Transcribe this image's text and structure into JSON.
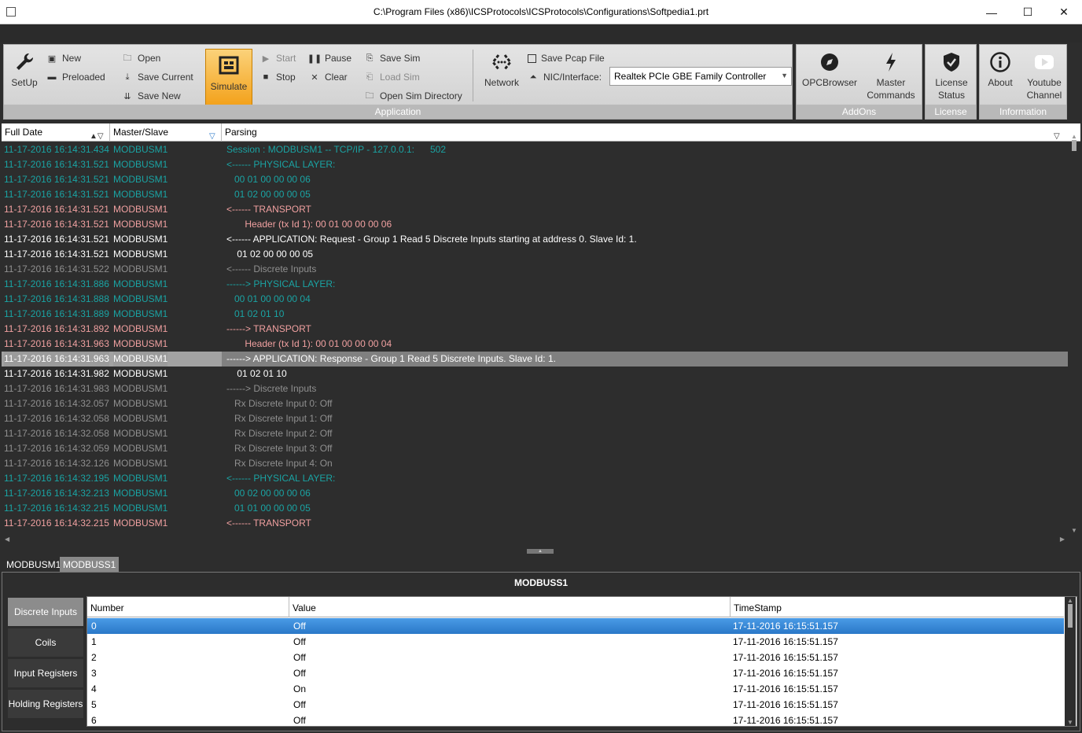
{
  "window": {
    "title": "C:\\Program Files (x86)\\ICSProtocols\\ICSProtocols\\Configurations\\Softpedia1.prt",
    "minimize": "—",
    "maximize": "☐",
    "close": "✕"
  },
  "ribbon": {
    "application": {
      "title": "Application",
      "setup": "SetUp",
      "new": "New",
      "preloaded": "Preloaded",
      "open": "Open",
      "save_current": "Save Current",
      "save_new": "Save New",
      "simulate": "Simulate",
      "start": "Start",
      "stop": "Stop",
      "pause": "Pause",
      "clear": "Clear",
      "save_sim": "Save Sim",
      "load_sim": "Load Sim",
      "open_sim_dir": "Open Sim Directory",
      "network": "Network",
      "save_pcap": "Save Pcap File",
      "nic_label": "NIC/Interface:",
      "nic_value": "Realtek PCIe GBE Family Controller"
    },
    "addons": {
      "title": "AddOns",
      "opcbrowser": "OPCBrowser",
      "master_commands_1": "Master",
      "master_commands_2": "Commands"
    },
    "license": {
      "title": "License",
      "license_status_1": "License",
      "license_status_2": "Status"
    },
    "information": {
      "title": "Information",
      "about": "About",
      "youtube_1": "Youtube",
      "youtube_2": "Channel"
    }
  },
  "log": {
    "columns": [
      "Full Date",
      "Master/Slave",
      "Parsing"
    ],
    "rows": [
      {
        "date": "11-17-2016 16:14:31.434",
        "ms": "MODBUSM1",
        "parsing": "Session : MODBUSM1 -- TCP/IP - 127.0.0.1:      502",
        "style": "teal"
      },
      {
        "date": "11-17-2016 16:14:31.521",
        "ms": "MODBUSM1",
        "parsing": "<------ PHYSICAL LAYER:",
        "style": "teal"
      },
      {
        "date": "11-17-2016 16:14:31.521",
        "ms": "MODBUSM1",
        "parsing": "   00 01 00 00 00 06",
        "style": "teal"
      },
      {
        "date": "11-17-2016 16:14:31.521",
        "ms": "MODBUSM1",
        "parsing": "   01 02 00 00 00 05",
        "style": "teal"
      },
      {
        "date": "11-17-2016 16:14:31.521",
        "ms": "MODBUSM1",
        "parsing": "<------ TRANSPORT",
        "style": "red"
      },
      {
        "date": "11-17-2016 16:14:31.521",
        "ms": "MODBUSM1",
        "parsing": "       Header (tx Id 1): 00 01 00 00 00 06",
        "style": "red"
      },
      {
        "date": "11-17-2016 16:14:31.521",
        "ms": "MODBUSM1",
        "parsing": "<------ APPLICATION: Request - Group 1 Read 5 Discrete Inputs starting at address 0. Slave Id: 1.",
        "style": "white"
      },
      {
        "date": "11-17-2016 16:14:31.521",
        "ms": "MODBUSM1",
        "parsing": "    01 02 00 00 00 05",
        "style": "white"
      },
      {
        "date": "11-17-2016 16:14:31.522",
        "ms": "MODBUSM1",
        "parsing": "<------ Discrete Inputs",
        "style": "gray"
      },
      {
        "date": "11-17-2016 16:14:31.886",
        "ms": "MODBUSM1",
        "parsing": "------> PHYSICAL LAYER:",
        "style": "teal"
      },
      {
        "date": "11-17-2016 16:14:31.888",
        "ms": "MODBUSM1",
        "parsing": "   00 01 00 00 00 04",
        "style": "teal"
      },
      {
        "date": "11-17-2016 16:14:31.889",
        "ms": "MODBUSM1",
        "parsing": "   01 02 01 10",
        "style": "teal"
      },
      {
        "date": "11-17-2016 16:14:31.892",
        "ms": "MODBUSM1",
        "parsing": "------> TRANSPORT",
        "style": "red"
      },
      {
        "date": "11-17-2016 16:14:31.963",
        "ms": "MODBUSM1",
        "parsing": "       Header (tx Id 1): 00 01 00 00 00 04",
        "style": "red"
      },
      {
        "date": "11-17-2016 16:14:31.963",
        "ms": "MODBUSM1",
        "parsing": "------> APPLICATION: Response - Group 1 Read 5 Discrete Inputs. Slave Id: 1.",
        "style": "sel"
      },
      {
        "date": "11-17-2016 16:14:31.982",
        "ms": "MODBUSM1",
        "parsing": "    01 02 01 10",
        "style": "white"
      },
      {
        "date": "11-17-2016 16:14:31.983",
        "ms": "MODBUSM1",
        "parsing": "------> Discrete Inputs",
        "style": "gray"
      },
      {
        "date": "11-17-2016 16:14:32.057",
        "ms": "MODBUSM1",
        "parsing": "   Rx Discrete Input 0: Off",
        "style": "gray"
      },
      {
        "date": "11-17-2016 16:14:32.058",
        "ms": "MODBUSM1",
        "parsing": "   Rx Discrete Input 1: Off",
        "style": "gray"
      },
      {
        "date": "11-17-2016 16:14:32.058",
        "ms": "MODBUSM1",
        "parsing": "   Rx Discrete Input 2: Off",
        "style": "gray"
      },
      {
        "date": "11-17-2016 16:14:32.059",
        "ms": "MODBUSM1",
        "parsing": "   Rx Discrete Input 3: Off",
        "style": "gray"
      },
      {
        "date": "11-17-2016 16:14:32.126",
        "ms": "MODBUSM1",
        "parsing": "   Rx Discrete Input 4: On",
        "style": "gray"
      },
      {
        "date": "11-17-2016 16:14:32.195",
        "ms": "MODBUSM1",
        "parsing": "<------ PHYSICAL LAYER:",
        "style": "teal"
      },
      {
        "date": "11-17-2016 16:14:32.213",
        "ms": "MODBUSM1",
        "parsing": "   00 02 00 00 00 06",
        "style": "teal"
      },
      {
        "date": "11-17-2016 16:14:32.215",
        "ms": "MODBUSM1",
        "parsing": "   01 01 00 00 00 05",
        "style": "teal"
      },
      {
        "date": "11-17-2016 16:14:32.215",
        "ms": "MODBUSM1",
        "parsing": "<------ TRANSPORT",
        "style": "red"
      }
    ]
  },
  "bottom": {
    "tabs": [
      "MODBUSM1",
      "MODBUSS1"
    ],
    "active_tab": 1,
    "panel_title": "MODBUSS1",
    "side_tabs": [
      "Discrete Inputs",
      "Coils",
      "Input Registers",
      "Holding Registers"
    ],
    "table": {
      "columns": [
        "Number",
        "Value",
        "TimeStamp"
      ],
      "rows": [
        {
          "number": "0",
          "value": "Off",
          "timestamp": "17-11-2016 16:15:51.157"
        },
        {
          "number": "1",
          "value": "Off",
          "timestamp": "17-11-2016 16:15:51.157"
        },
        {
          "number": "2",
          "value": "Off",
          "timestamp": "17-11-2016 16:15:51.157"
        },
        {
          "number": "3",
          "value": "Off",
          "timestamp": "17-11-2016 16:15:51.157"
        },
        {
          "number": "4",
          "value": "On",
          "timestamp": "17-11-2016 16:15:51.157"
        },
        {
          "number": "5",
          "value": "Off",
          "timestamp": "17-11-2016 16:15:51.157"
        },
        {
          "number": "6",
          "value": "Off",
          "timestamp": "17-11-2016 16:15:51.157"
        }
      ]
    }
  },
  "colors": {
    "teal": "#1aa3a3",
    "red": "#f0a0a0",
    "simulate": "#f3a21c",
    "selection": "#2a78c8"
  }
}
